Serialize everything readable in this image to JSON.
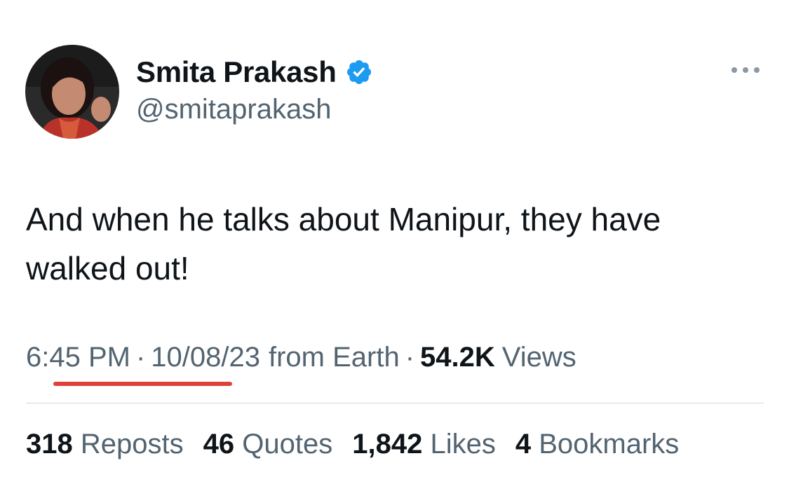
{
  "author": {
    "name": "Smita Prakash",
    "handle": "@smitaprakash",
    "verified": true,
    "avatar_icon": "profile-photo"
  },
  "more_icon": "more-horizontal-icon",
  "tweet": {
    "text": "And when he talks about Manipur, they have walked out!"
  },
  "meta": {
    "time": "6:45 PM",
    "date": "10/08/23",
    "source": "from Earth",
    "views_count": "54.2K",
    "views_label": "Views",
    "separator": "·"
  },
  "stats": {
    "reposts_count": "318",
    "reposts_label": "Reposts",
    "quotes_count": "46",
    "quotes_label": "Quotes",
    "likes_count": "1,842",
    "likes_label": "Likes",
    "bookmarks_count": "4",
    "bookmarks_label": "Bookmarks"
  },
  "colors": {
    "verified": "#1d9bf0",
    "underline_mark": "#e0403a",
    "secondary_text": "#536471",
    "primary_text": "#0f1419"
  }
}
